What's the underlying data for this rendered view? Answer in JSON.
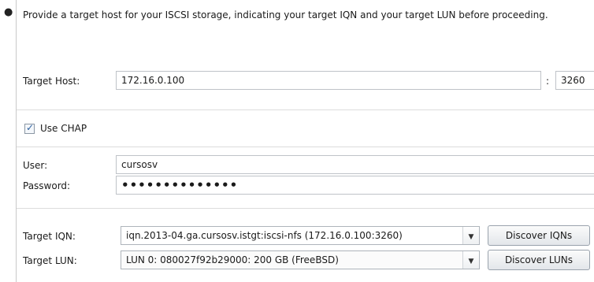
{
  "intro": "Provide a target host for your ISCSI storage, indicating your target IQN and your target LUN before proceeding.",
  "target_host": {
    "label": "Target Host:",
    "value": "172.16.0.100",
    "port_sep": ":",
    "port": "3260"
  },
  "chap": {
    "checked": true,
    "label": "Use CHAP"
  },
  "user": {
    "label": "User:",
    "value": "cursosv"
  },
  "password": {
    "label": "Password:",
    "value": "••••••••••••••"
  },
  "target_iqn": {
    "label": "Target IQN:",
    "value": "iqn.2013-04.ga.cursosv.istgt:iscsi-nfs (172.16.0.100:3260)",
    "button": "Discover IQNs"
  },
  "target_lun": {
    "label": "Target LUN:",
    "value": "LUN 0: 080027f92b29000: 200 GB (FreeBSD)",
    "button": "Discover LUNs"
  }
}
